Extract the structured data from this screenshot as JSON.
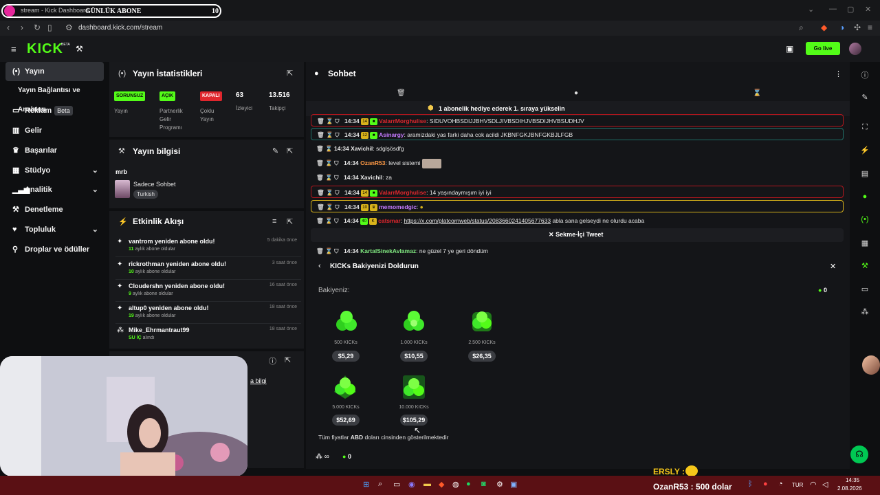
{
  "browser": {
    "tab_title": "stream - Kick Dashboard",
    "sub_label": "GÜNLÜK ABONE",
    "sub_count": "10",
    "url": "dashboard.kick.com/stream"
  },
  "header": {
    "logo": "KICK",
    "logo_badge": "BETA",
    "go_live": "Go live"
  },
  "sidebar": {
    "items": [
      {
        "label": "Yayın",
        "icon": "broadcast-icon"
      },
      {
        "label": "Yayın Bağlantısı ve Anahtarı",
        "icon": ""
      },
      {
        "label": "Reklam",
        "icon": "ad-icon",
        "badge": "Beta"
      },
      {
        "label": "Gelir",
        "icon": "revenue-icon"
      },
      {
        "label": "Başarılar",
        "icon": "trophy-icon"
      },
      {
        "label": "Stüdyo",
        "icon": "studio-icon"
      },
      {
        "label": "Analitik",
        "icon": "analytics-icon"
      },
      {
        "label": "Denetleme",
        "icon": "moderation-icon"
      },
      {
        "label": "Topluluk",
        "icon": "community-icon"
      },
      {
        "label": "Droplar ve ödüller",
        "icon": "drops-icon"
      }
    ]
  },
  "stats": {
    "title": "Yayın İstatistikleri",
    "items": [
      {
        "tag": "SORUNSUZ",
        "label": "Yayın",
        "tag_color": "#53fc18"
      },
      {
        "tag": "AÇIK",
        "label_lines": [
          "Partnerlik",
          "Gelir",
          "Programı"
        ],
        "tag_color": "#53fc18"
      },
      {
        "tag": "KAPALI",
        "label_lines": [
          "Çoklu",
          "Yayın"
        ],
        "tag_color": "#e0262d"
      },
      {
        "value": "63",
        "label": "İzleyici"
      },
      {
        "value": "13.516",
        "label": "Takipçi"
      }
    ]
  },
  "stream_info": {
    "title": "Yayın bilgisi",
    "stream_title": "mrb",
    "category": "Sadece Sohbet",
    "language": "Turkish"
  },
  "activity": {
    "title": "Etkinlik Akışı",
    "items": [
      {
        "name": "vantrom yeniden abone oldu!",
        "count": "11",
        "sub": "aylık abone oldular",
        "time": "5 dakika önce"
      },
      {
        "name": "rickrothman yeniden abone oldu!",
        "count": "10",
        "sub": "aylık abone oldular",
        "time": "3 saat önce"
      },
      {
        "name": "Cloudershn yeniden abone oldu!",
        "count": "9",
        "sub": "aylık abone oldular",
        "time": "16 saat önce"
      },
      {
        "name": "altup0 yeniden abone oldu!",
        "count": "19",
        "sub": "aylık abone oldular",
        "time": "18 saat önce"
      },
      {
        "name": "Mike_Ehrmantraut99",
        "count": "SU İÇ",
        "sub": "alındı",
        "time": "18 saat önce"
      }
    ],
    "partial_link": "a bilgi"
  },
  "chat": {
    "title": "Sohbet",
    "pinned": "1 abonelik hediye ederek 1. sıraya yükselin",
    "messages": [
      {
        "time": "14:34",
        "lvl": "14",
        "user": "ValarrMorghulise",
        "text": "SIDUVOHBSDIJJBHVSDLJIVBSDIHJVBSDIJHVBSUDHJV"
      },
      {
        "time": "14:34",
        "lvl": "12",
        "user": "Asinargy",
        "text": "aramizdaki yas farki daha cok acildi JKBNFGKJBNFGKBJLFGB"
      },
      {
        "time": "14:34",
        "user": "Xavichil",
        "text": "sdglşösdfg"
      },
      {
        "time": "14:34",
        "user": "OzanR53",
        "text": "level sistemi"
      },
      {
        "time": "14:34",
        "user": "Xavichil",
        "text": "za"
      },
      {
        "time": "14:34",
        "lvl": "14",
        "user": "ValarrMorghulise",
        "text": "14 yaşındaymışım iyi iyi"
      },
      {
        "time": "14:34",
        "lvl": "10",
        "user": "memomedgic",
        "text": ""
      },
      {
        "time": "14:34",
        "lvl": "40",
        "user": "catsmar",
        "link": "https://x.com/platcornweb/status/2083660241405677633",
        "text": "abla sana gelseydi ne olurdu acaba"
      },
      {
        "time": "14:34",
        "user": "KartalSinekAvlamaz",
        "text": "ne güzel 7 ye geri döndüm"
      }
    ],
    "tweet_label": "Sekme-İçi Tweet"
  },
  "kicks": {
    "title": "KICKs Bakiyenizi Doldurun",
    "balance_label": "Bakiyeniz:",
    "balance": "0",
    "packs": [
      {
        "amount": "500 KICKs",
        "price": "$5,29"
      },
      {
        "amount": "1.000 KICKs",
        "price": "$10,55"
      },
      {
        "amount": "2.500 KICKs",
        "price": "$26,35"
      },
      {
        "amount": "5.000 KICKs",
        "price": "$52,69"
      },
      {
        "amount": "10.000 KICKs",
        "price": "$105,29"
      }
    ],
    "footer_prefix": "Tüm fiyatlar ",
    "footer_bold": "ABD",
    "footer_suffix": " doları cinsinden gösterilmektedir",
    "infinite": "∞",
    "zero": "0"
  },
  "overlay": {
    "ersly": "ERSLY :",
    "donation_user": "OzanR53 :",
    "donation_amount": "500 dolar"
  },
  "taskbar": {
    "lang": "TUR",
    "time": "14:35",
    "date": "2.08.2026"
  },
  "colors": {
    "accent": "#53fc18",
    "danger": "#e0262d",
    "gold": "#d6b11a",
    "taskbar": "#5a1014"
  }
}
